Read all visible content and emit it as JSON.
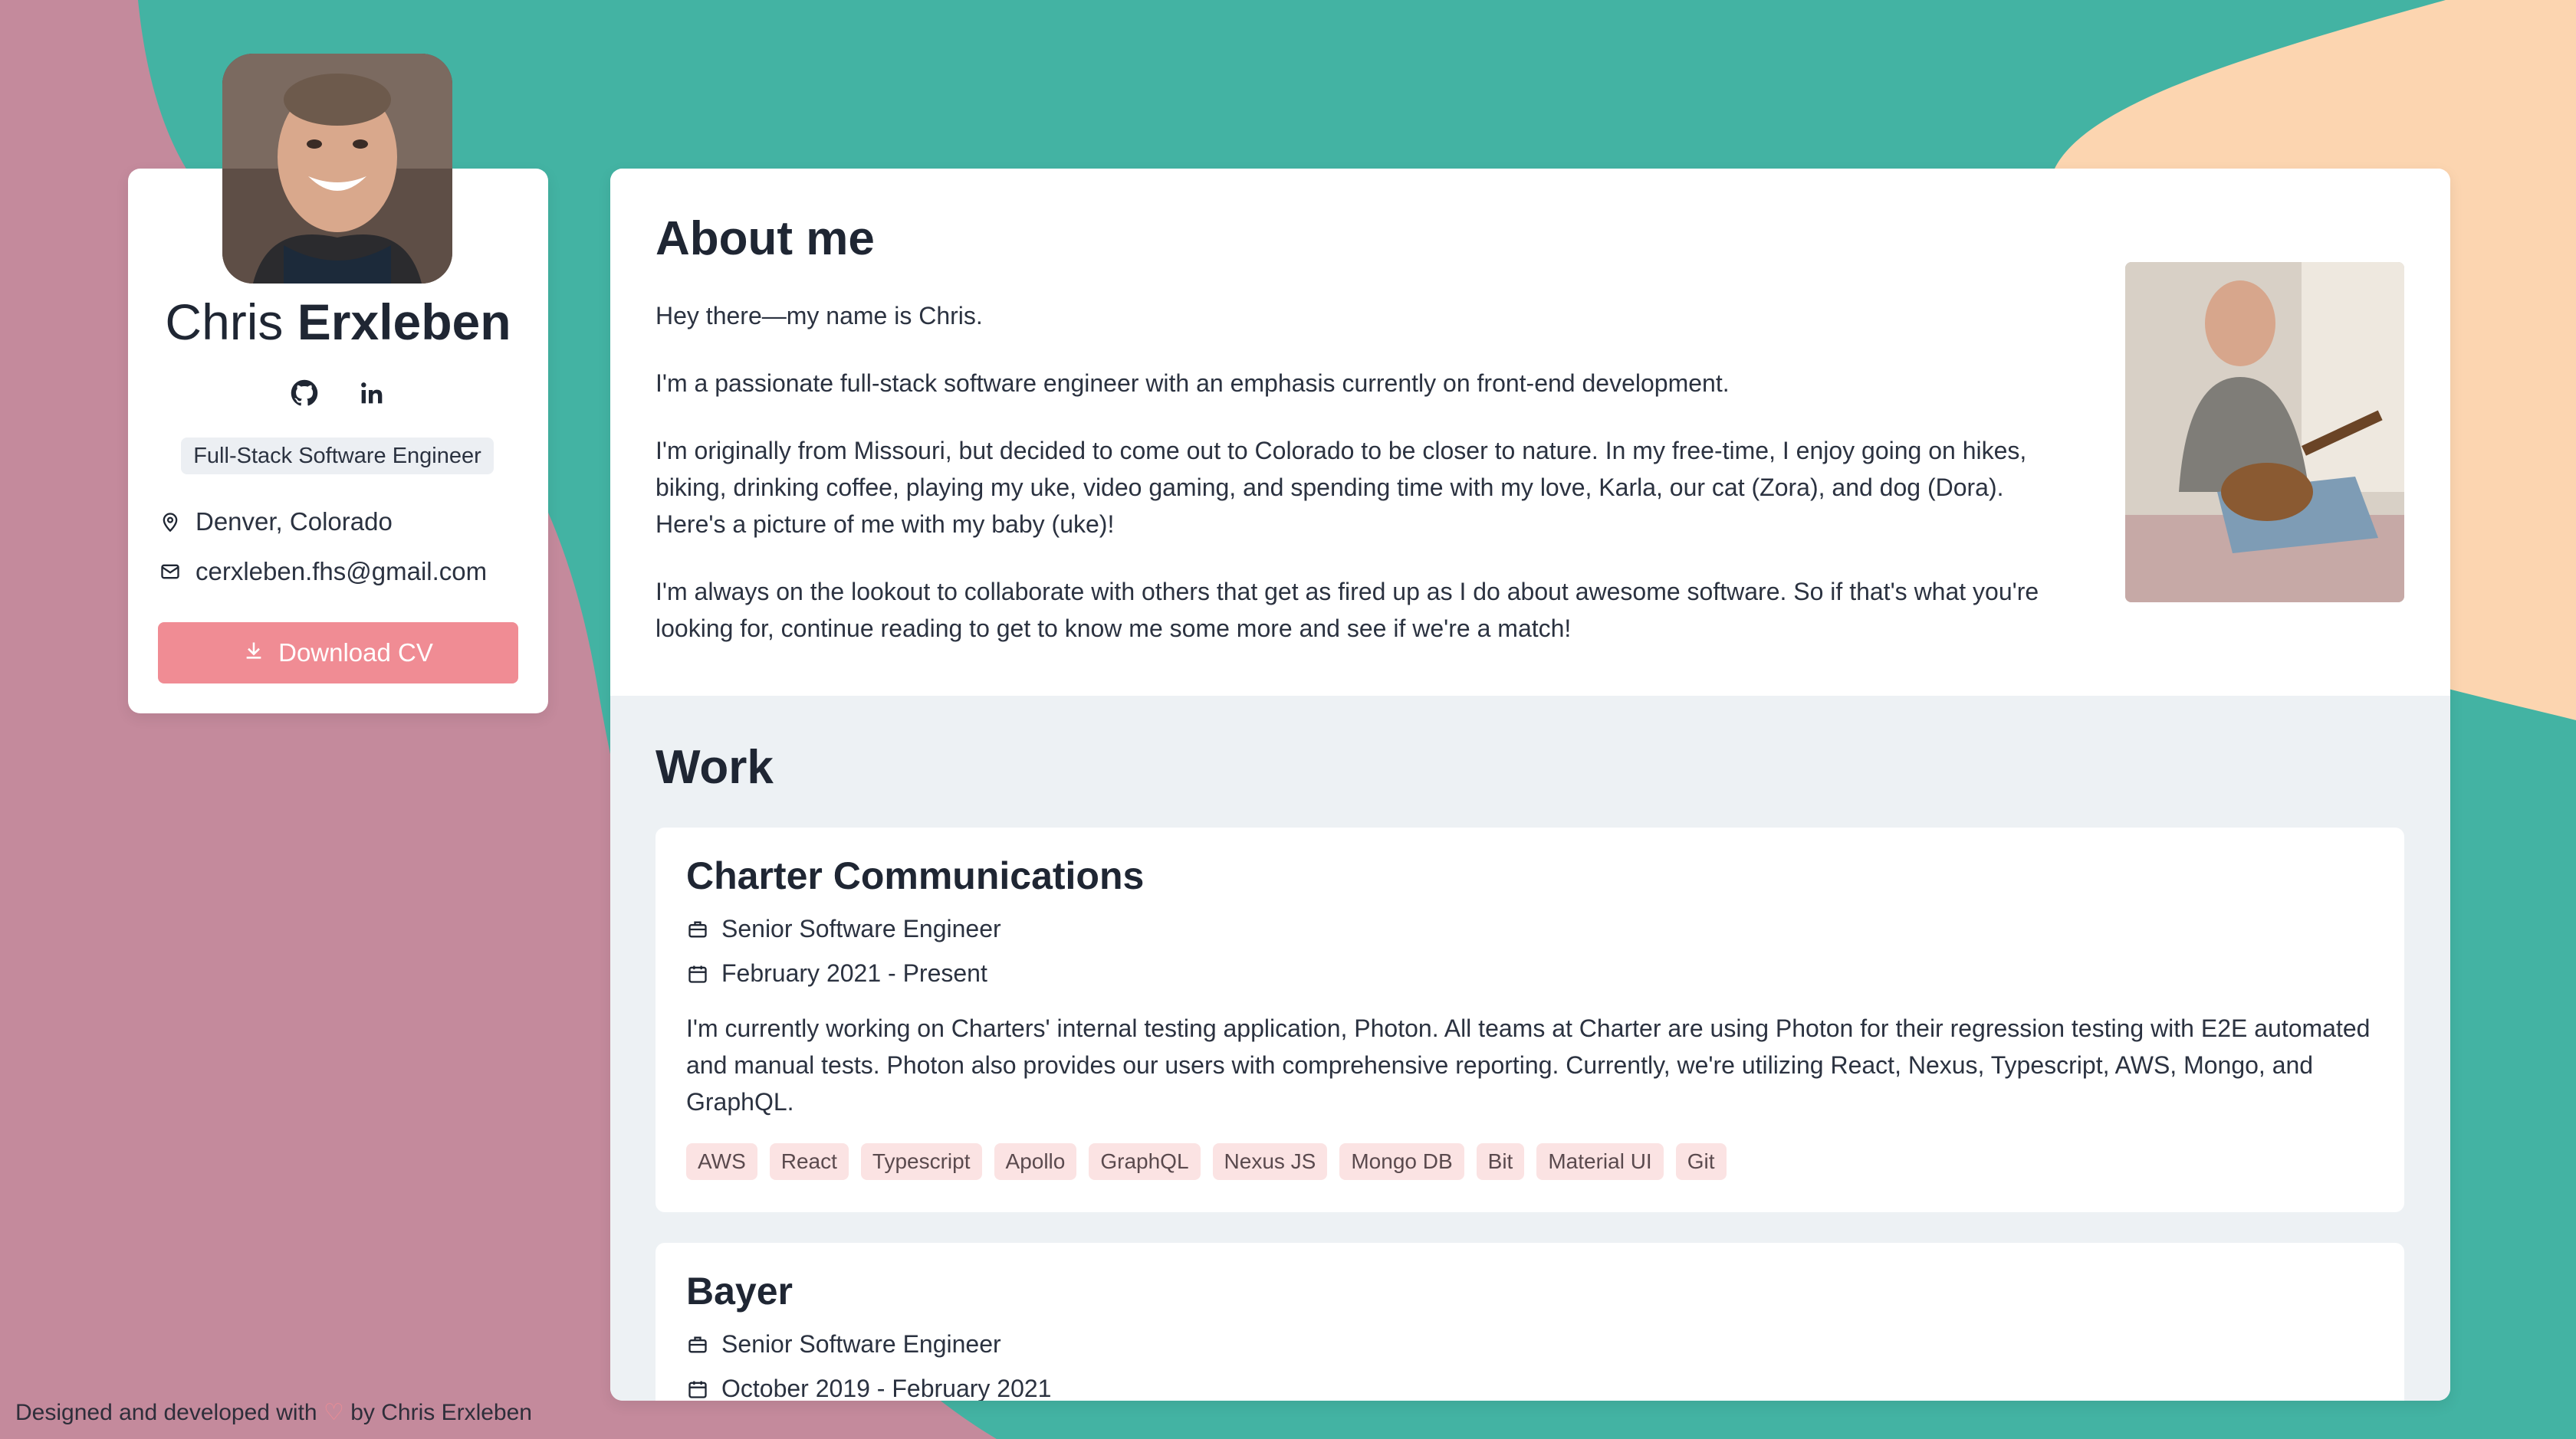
{
  "colors": {
    "page_bg_pink": "#c48a9c",
    "teal": "#43b3a3",
    "peach": "#fcd5b0",
    "accent": "#f08c94",
    "tag_bg": "#fbe3e3",
    "work_bg": "#edf1f4"
  },
  "profile": {
    "first_name": "Chris",
    "last_name": "Erxleben",
    "social": [
      {
        "icon": "github-icon"
      },
      {
        "icon": "linkedin-icon"
      }
    ],
    "title": "Full-Stack Software Engineer",
    "location": "Denver, Colorado",
    "email": "cerxleben.fhs@gmail.com",
    "download_label": "Download CV"
  },
  "about": {
    "heading": "About me",
    "paragraphs": [
      "Hey there—my name is Chris.",
      "I'm a passionate full-stack software engineer with an emphasis currently on front-end development.",
      "I'm originally from Missouri, but decided to come out to Colorado to be closer to nature. In my free-time, I enjoy going on hikes, biking, drinking coffee, playing my uke, video gaming, and spending time with my love, Karla, our cat (Zora), and dog (Dora). Here's a picture of me with my baby (uke)!",
      "I'm always on the lookout to collaborate with others that get as fired up as I do about awesome software. So if that's what you're looking for, continue reading to get to know me some more and see if we're a match!"
    ]
  },
  "work": {
    "heading": "Work",
    "jobs": [
      {
        "company": "Charter Communications",
        "role": "Senior Software Engineer",
        "dates": "February 2021 - Present",
        "description": "I'm currently working on Charters' internal testing application, Photon. All teams at Charter are using Photon for their regression testing with E2E automated and manual tests. Photon also provides our users with comprehensive reporting. Currently, we're utilizing React, Nexus, Typescript, AWS, Mongo, and GraphQL.",
        "tags": [
          "AWS",
          "React",
          "Typescript",
          "Apollo",
          "GraphQL",
          "Nexus JS",
          "Mongo DB",
          "Bit",
          "Material UI",
          "Git"
        ]
      },
      {
        "company": "Bayer",
        "role": "Senior Software Engineer",
        "dates": "October 2019 - February 2021"
      }
    ]
  },
  "footer": {
    "prefix": "Designed and developed with",
    "heart": "♡",
    "suffix": "by Chris Erxleben"
  }
}
